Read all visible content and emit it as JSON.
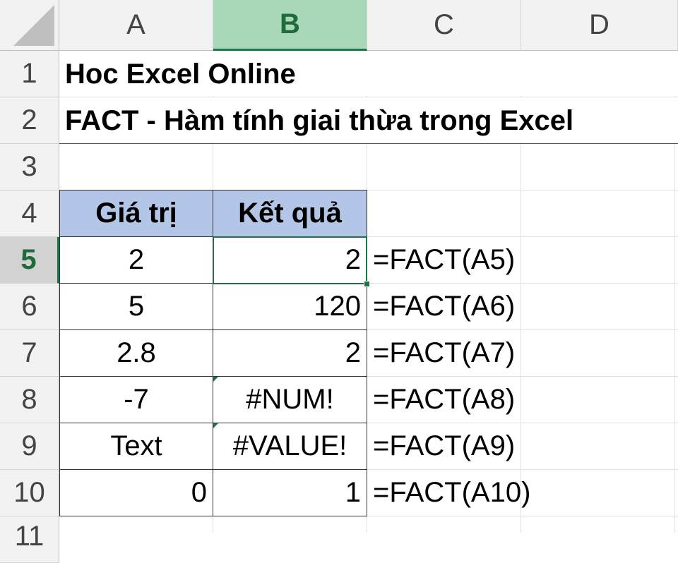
{
  "columns": [
    {
      "label": "A",
      "selected": false
    },
    {
      "label": "B",
      "selected": true
    },
    {
      "label": "C",
      "selected": false
    },
    {
      "label": "D",
      "selected": false
    }
  ],
  "rows": [
    "1",
    "2",
    "3",
    "4",
    "5",
    "6",
    "7",
    "8",
    "9",
    "10",
    "11"
  ],
  "selected_row": "5",
  "title": "Hoc Excel Online",
  "subtitle": "FACT - Hàm tính giai thừa trong Excel",
  "table": {
    "headers": [
      "Giá trị",
      "Kết quả"
    ],
    "rows": [
      {
        "value": "2",
        "result": "2",
        "formula": "=FACT(A5)"
      },
      {
        "value": "5",
        "result": "120",
        "formula": "=FACT(A6)"
      },
      {
        "value": "2.8",
        "result": "2",
        "formula": "=FACT(A7)"
      },
      {
        "value": "-7",
        "result": "#NUM!",
        "formula": "=FACT(A8)"
      },
      {
        "value": "Text",
        "result": "#VALUE!",
        "formula": "=FACT(A9)"
      },
      {
        "value": "0",
        "result": "1",
        "formula": "=FACT(A10)"
      }
    ]
  },
  "colors": {
    "header_fill": "#b4c6e7",
    "selection": "#217346"
  }
}
